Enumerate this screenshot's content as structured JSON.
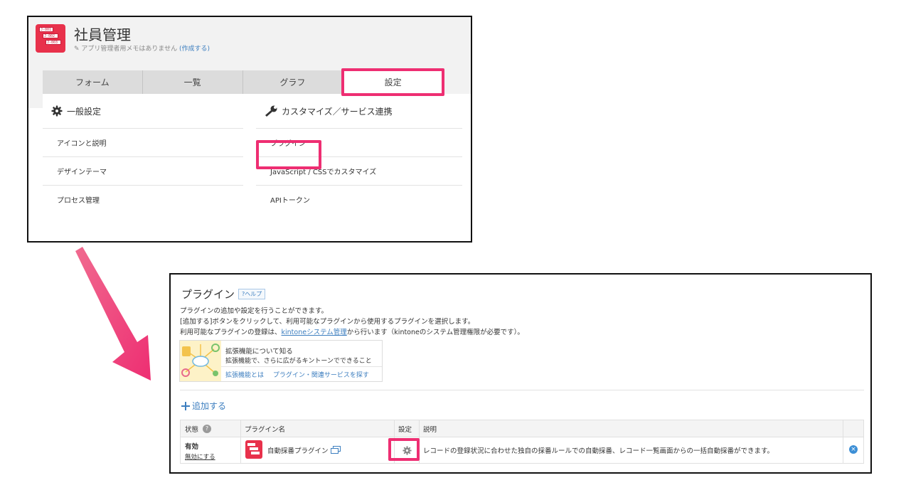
{
  "app": {
    "title": "社員管理",
    "memo_text": "アプリ管理者用メモはありません",
    "memo_link": "(作成する)",
    "icon_rows": [
      "J-001",
      "J-002",
      "J-003"
    ]
  },
  "tabs": [
    {
      "label": "フォーム"
    },
    {
      "label": "一覧"
    },
    {
      "label": "グラフ"
    },
    {
      "label": "設定"
    }
  ],
  "settings": {
    "general_heading": "一般設定",
    "general_items": [
      "アイコンと説明",
      "デザインテーマ",
      "プロセス管理"
    ],
    "custom_heading": "カスタマイズ／サービス連携",
    "custom_items": [
      "プラグイン",
      "JavaScript / CSSでカスタマイズ",
      "APIトークン"
    ]
  },
  "plugin_page": {
    "title": "プラグイン",
    "help_label": "?ヘルプ",
    "desc1": "プラグインの追加や設定を行うことができます。",
    "desc2": "[追加する]ボタンをクリックして、利用可能なプラグインから使用するプラグインを選択します。",
    "desc3_before": "利用可能なプラグインの登録は、",
    "desc3_link": "kintoneシステム管理",
    "desc3_after": "から行います（kintoneのシステム管理権限が必要です）。",
    "ext_title": "拡張機能について知る",
    "ext_sub": "拡張機能で、さらに広がるキントーンでできること",
    "ext_link1": "拡張機能とは",
    "ext_link2": "プラグイン・関連サービスを探す",
    "add_label": "追加する",
    "columns": {
      "status": "状態",
      "name": "プラグイン名",
      "settings": "設定",
      "description": "説明"
    },
    "rows": [
      {
        "status": "有効",
        "disable_link": "無効にする",
        "name": "自動採番プラグイン",
        "description": "レコードの登録状況に合わせた独自の採番ルールでの自動採番、レコード一覧画面からの一括自動採番ができます。"
      }
    ]
  },
  "colors": {
    "highlight": "#ee2e72",
    "link": "#3c7ebf",
    "app_icon": "#e8314b"
  }
}
